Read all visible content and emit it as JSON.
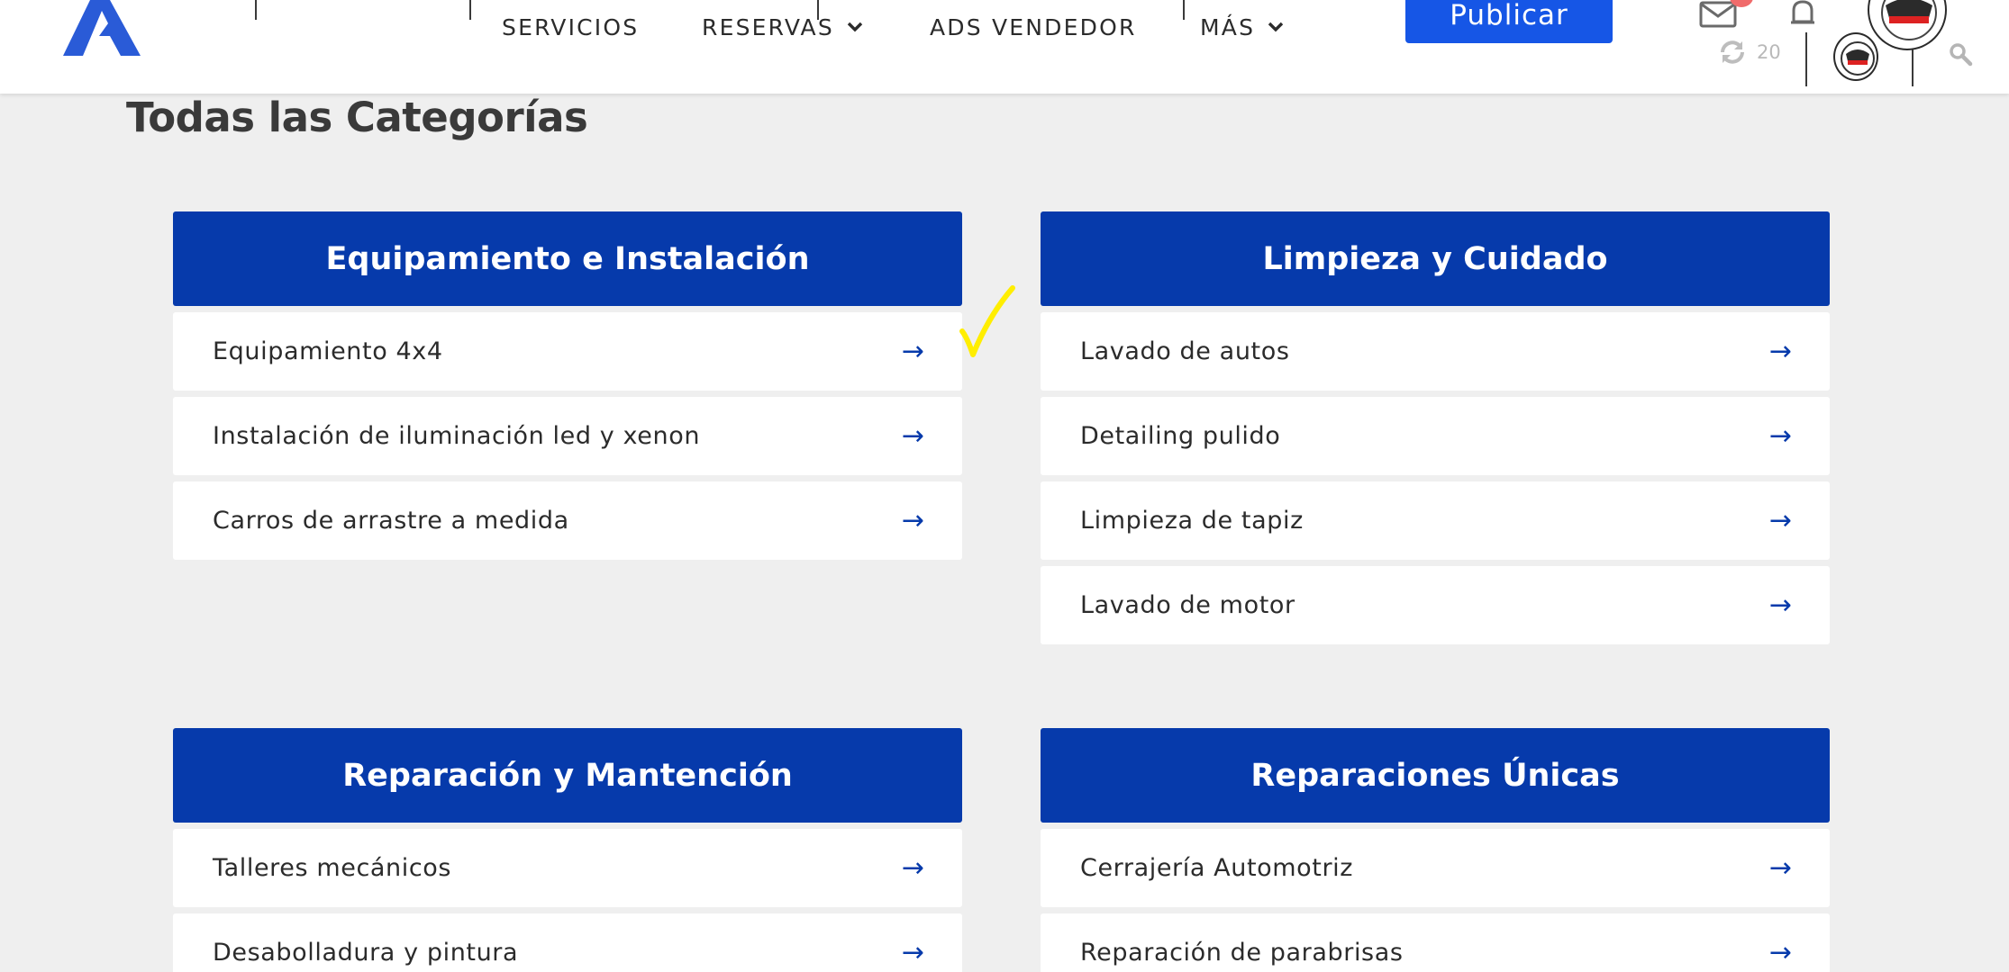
{
  "nav": {
    "items": [
      {
        "label": "SERVICIOS",
        "has_dropdown": false
      },
      {
        "label": "RESERVAS",
        "has_dropdown": true
      },
      {
        "label": "ADS VENDEDOR",
        "has_dropdown": false
      },
      {
        "label": "MÁS",
        "has_dropdown": true
      }
    ],
    "publish_label": "Publicar",
    "sync_count": "20"
  },
  "page": {
    "title": "Todas las Categorías"
  },
  "categories": [
    {
      "title": "Equipamiento e Instalación",
      "items": [
        "Equipamiento 4x4",
        "Instalación de iluminación led y xenon",
        "Carros de arrastre a medida"
      ]
    },
    {
      "title": "Limpieza y Cuidado",
      "items": [
        "Lavado de autos",
        "Detailing pulido",
        "Limpieza de tapiz",
        "Lavado de motor"
      ]
    },
    {
      "title": "Reparación y Mantención",
      "items": [
        "Talleres mecánicos",
        "Desabolladura y pintura"
      ]
    },
    {
      "title": "Reparaciones Únicas",
      "items": [
        "Cerrajería Automotriz",
        "Reparación de parabrisas"
      ]
    }
  ],
  "icons": {
    "arrow": "→"
  },
  "colors": {
    "brand_blue": "#063aab",
    "button_blue": "#1656e6",
    "logo_blue": "#2a5bd7",
    "background": "#efefef",
    "notification_badge": "#f06b6b",
    "checkmark": "#ffee00"
  }
}
